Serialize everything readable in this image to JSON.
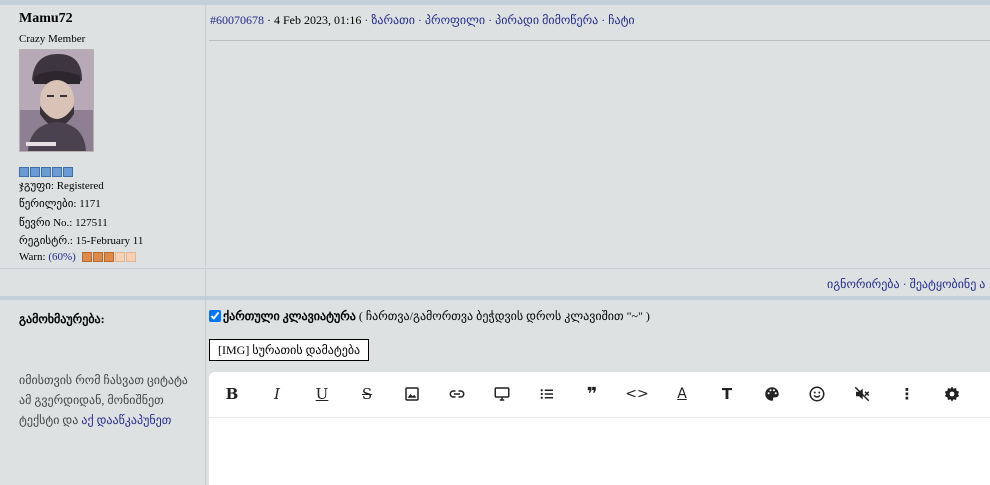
{
  "post": {
    "user": {
      "name": "Mamu72",
      "rank": "Crazy Member",
      "stars": 5,
      "group_label": "ჯგუფი:",
      "group_value": "Registered",
      "posts_label": "წერილები:",
      "posts_value": "1171",
      "member_label": "წევრი No.:",
      "member_value": "127511",
      "reg_label": "რეგისტრ.:",
      "reg_value": "15-February 11",
      "warn_label": "Warn:",
      "warn_value": "(60%)",
      "warn_fraction": 0.6
    },
    "header": {
      "post_id": "#60070678",
      "date": "4 Feb 2023, 01:16",
      "links": [
        "ზარათი",
        "პროფილი",
        "პირადი მიმოწერა",
        "ჩატი"
      ]
    },
    "footer": {
      "ignore": "იგნორირება",
      "report": "შეატყობინე ა"
    }
  },
  "reply": {
    "label": "გამოხმაურება:",
    "hint_text": "იმისთვის რომ ჩასვათ ციტატა ამ გვერდიდან, მონიშნეთ ტექსტი და",
    "hint_link": "აქ დააწკაპუნეთ",
    "keyboard_label": "ქართული კლავიატურა",
    "keyboard_note": "( ჩართვა/გამორთვა ბეჭდვის დროს კლავიშით \"~\" )",
    "img_button": "[IMG] სურათის დამატება"
  },
  "toolbar": {
    "bold": "B",
    "italic": "I",
    "underline": "U",
    "strike": "S",
    "quote": "❞",
    "code": "<>",
    "font_color": "A",
    "font_size": "T",
    "more": "⋮"
  }
}
